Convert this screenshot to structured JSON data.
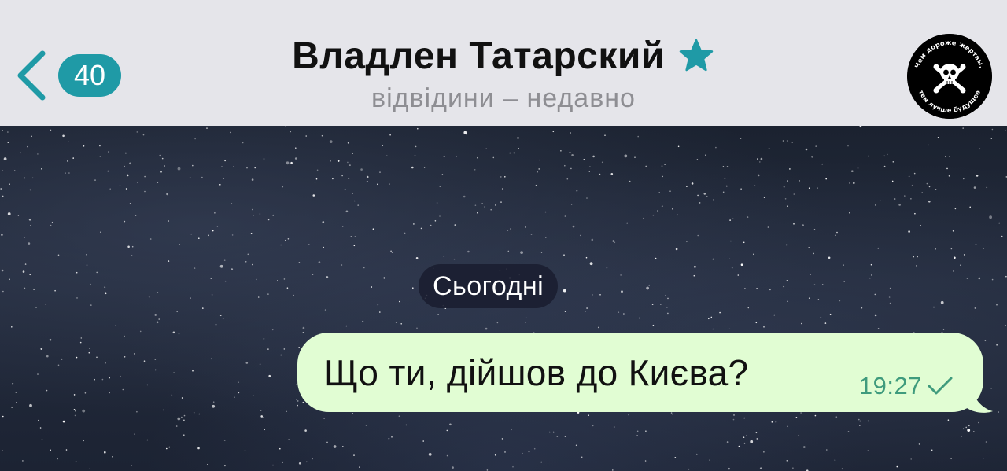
{
  "header": {
    "back_label": "<",
    "unread_count": "40",
    "contact_name": "Владлен Татарский",
    "contact_status": "відвідини – недавно",
    "favorite_icon": "star-icon",
    "accent_color": "#1f9aa6",
    "avatar": {
      "icon": "skull-crossbones-icon",
      "top_text": "Чем дороже жертвы,",
      "bottom_text": "тем лучше будущее"
    }
  },
  "chat": {
    "background": "starry-night-sky",
    "date_separator": "Сьогодні",
    "messages": [
      {
        "direction": "outgoing",
        "text": "Що ти, дійшов до Києва?",
        "time": "19:27",
        "status_icon": "single-check-icon",
        "bubble_color": "#e1fdd3"
      }
    ]
  }
}
